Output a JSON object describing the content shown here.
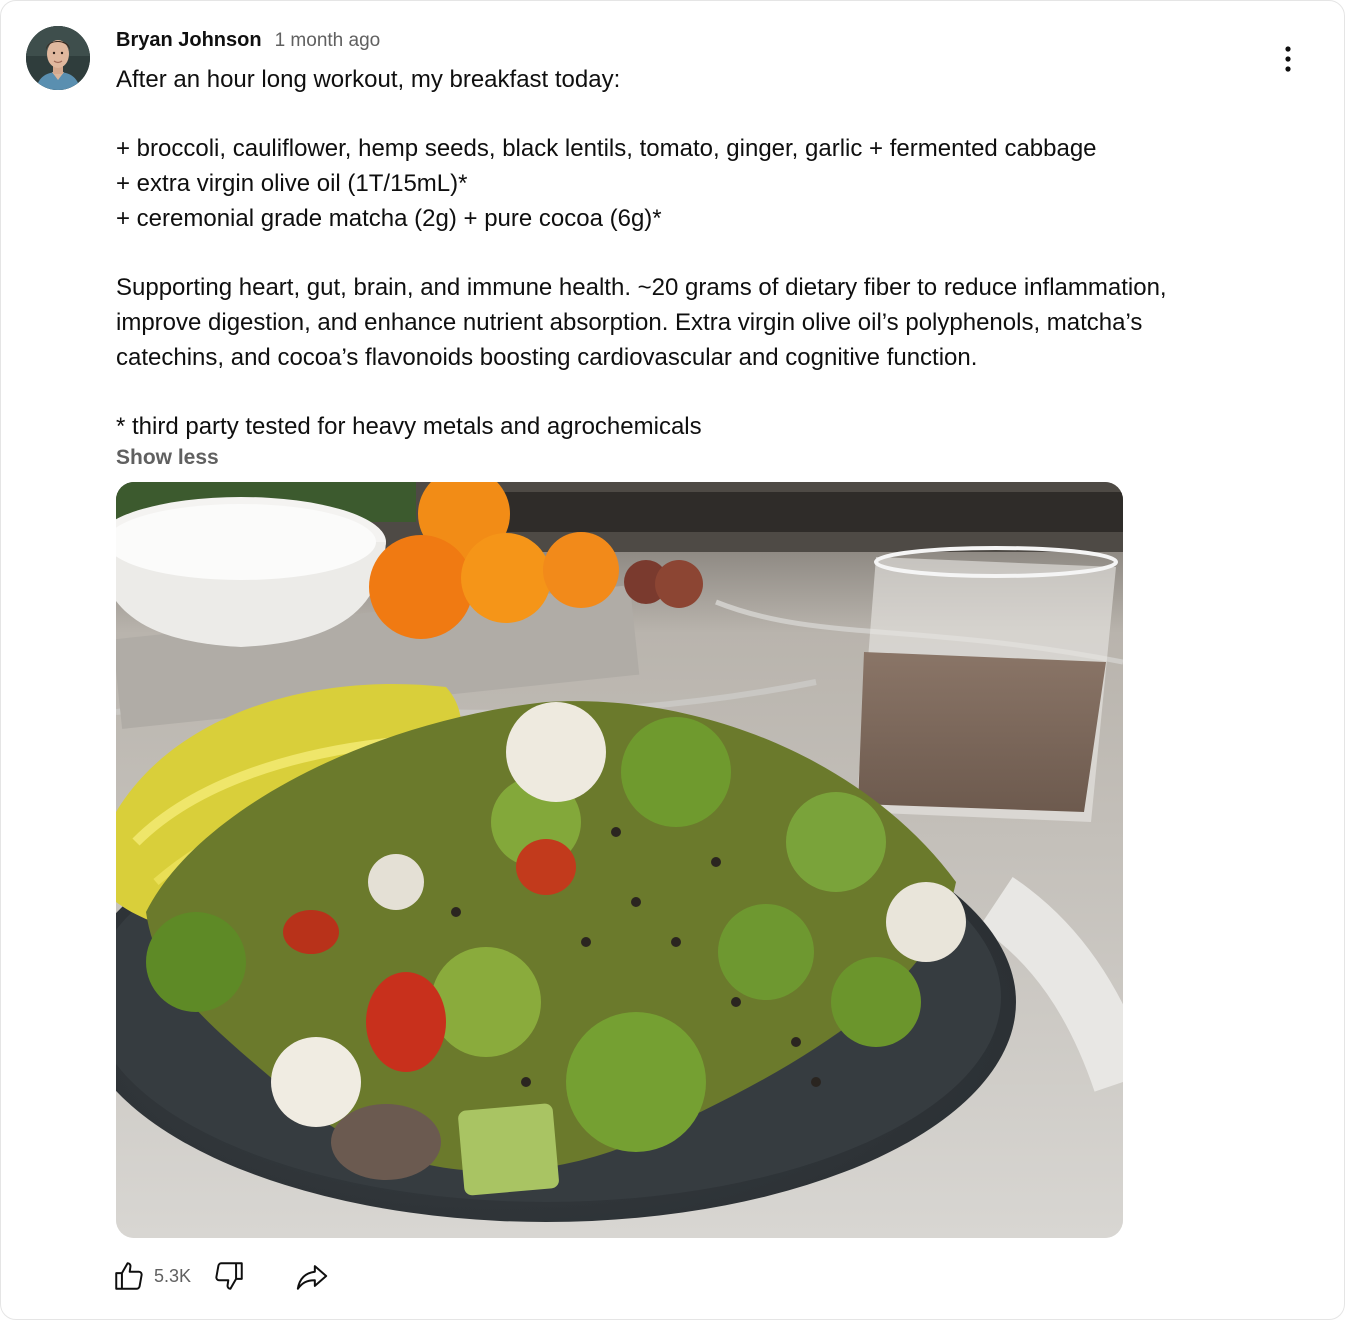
{
  "post": {
    "author": "Bryan Johnson",
    "time": "1 month ago",
    "text": "After an hour long workout, my breakfast today:\n\n+ broccoli, cauliflower, hemp seeds, black lentils, tomato, ginger, garlic + fermented cabbage\n+ extra virgin olive oil (1T/15mL)*\n+ ceremonial grade matcha (2g) + pure cocoa (6g)*\n\nSupporting heart, gut, brain, and immune health. ~20 grams of dietary fiber to reduce inflammation, improve digestion, and enhance nutrient absorption. Extra virgin olive oil’s polyphenols, matcha’s catechins, and cocoa’s flavonoids boosting cardiovascular and cognitive function.\n\n* third party tested for heavy metals and agrochemicals",
    "show_less": "Show less"
  },
  "actions": {
    "like_count": "5.3K"
  },
  "icons": {
    "menu": "more-vert-icon",
    "like": "thumb-up-icon",
    "dislike": "thumb-down-icon",
    "share": "share-icon"
  },
  "colors": {
    "text_primary": "#0f0f0f",
    "text_secondary": "#606060",
    "border": "#e5e5e5"
  }
}
